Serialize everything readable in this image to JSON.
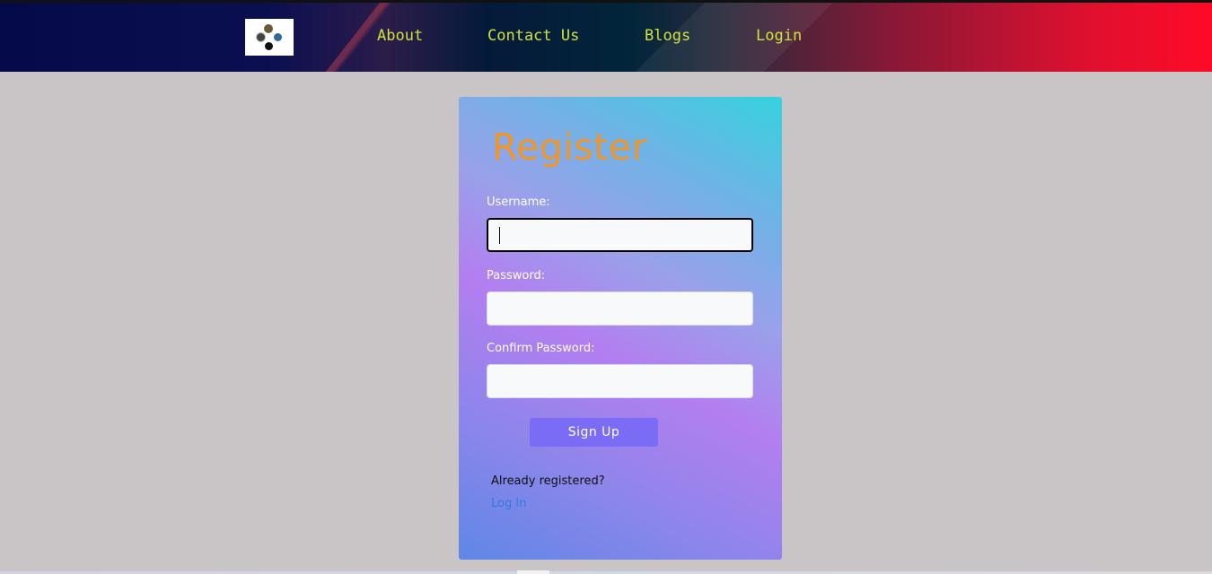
{
  "nav": {
    "logo_icon": "logo-icon",
    "links": [
      {
        "label": "About"
      },
      {
        "label": "Contact Us"
      },
      {
        "label": "Blogs"
      },
      {
        "label": "Login"
      }
    ],
    "link_color": "#cfe23a"
  },
  "form": {
    "title": "Register",
    "title_color": "#f0952a",
    "username": {
      "label": "Username:",
      "value": "",
      "placeholder": ""
    },
    "password": {
      "label": "Password:",
      "value": "",
      "placeholder": ""
    },
    "confirm_password": {
      "label": "Confirm Password:",
      "value": "",
      "placeholder": ""
    },
    "submit_label": "Sign Up",
    "submit_color": "#7b6cf6",
    "already_text": "Already registered?",
    "login_link": "Log In",
    "link_color": "#2f7be0"
  }
}
